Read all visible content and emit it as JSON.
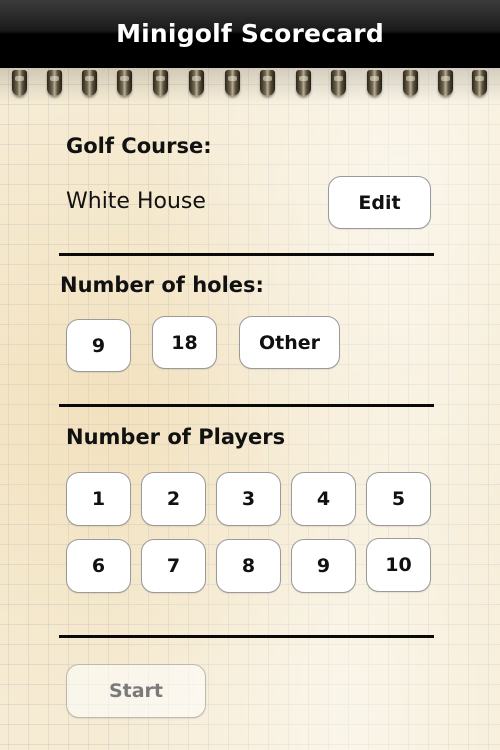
{
  "header": {
    "title": "Minigolf Scorecard"
  },
  "golf_course": {
    "label": "Golf Course:",
    "value": "White House",
    "edit_label": "Edit"
  },
  "holes": {
    "label": "Number of holes:",
    "options": [
      "9",
      "18",
      "Other"
    ]
  },
  "players": {
    "label": "Number of Players",
    "options": [
      "1",
      "2",
      "3",
      "4",
      "5",
      "6",
      "7",
      "8",
      "9",
      "10"
    ]
  },
  "start": {
    "label": "Start",
    "enabled": false
  }
}
